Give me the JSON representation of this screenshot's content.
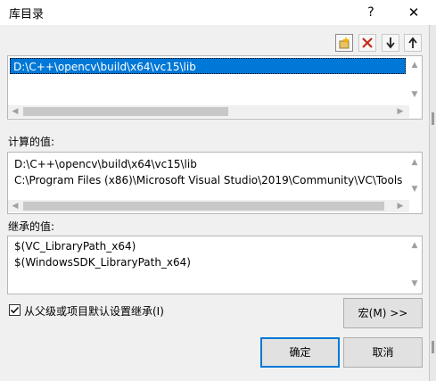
{
  "dialog": {
    "title": "库目录",
    "help": "?",
    "close": "✕"
  },
  "toolbar": {
    "new_line": "new-line-icon",
    "delete": "delete-icon",
    "move_down": "arrow-down-icon",
    "move_up": "arrow-up-icon"
  },
  "directories": {
    "items": [
      "D:\\C++\\opencv\\build\\x64\\vc15\\lib"
    ]
  },
  "computed": {
    "label": "计算的值:",
    "lines": [
      "D:\\C++\\opencv\\build\\x64\\vc15\\lib",
      "C:\\Program Files (x86)\\Microsoft Visual Studio\\2019\\Community\\VC\\Tools"
    ]
  },
  "inherited": {
    "label": "继承的值:",
    "lines": [
      "$(VC_LibraryPath_x64)",
      "$(WindowsSDK_LibraryPath_x64)"
    ]
  },
  "inherit_checkbox": {
    "label": "从父级或项目默认设置继承(I)",
    "checked": true
  },
  "buttons": {
    "macros": "宏(M) >>",
    "ok": "确定",
    "cancel": "取消"
  },
  "colors": {
    "selection": "#0078d7",
    "delete_icon": "#c42b1c",
    "default_button_border": "#0078d7"
  }
}
